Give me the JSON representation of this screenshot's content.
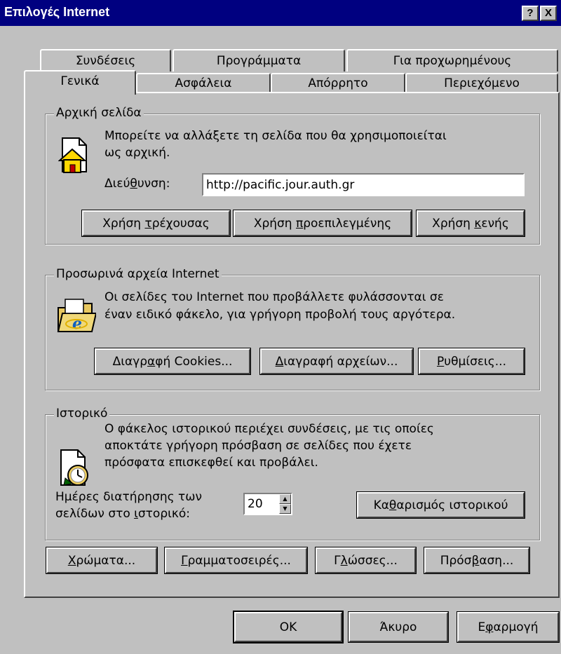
{
  "window": {
    "title": "Επιλογές Internet",
    "help_button": "?",
    "close_button": "X"
  },
  "tabs": {
    "row_back": [
      "Συνδέσεις",
      "Προγράμματα",
      "Για προχωρημένους"
    ],
    "row_front": [
      "Γενικά",
      "Ασφάλεια",
      "Απόρρητο",
      "Περιεχόμενο"
    ],
    "selected": "Γενικά"
  },
  "home_page": {
    "legend": "Αρχική σελίδα",
    "description_line1": "Μπορείτε να αλλάξετε τη σελίδα που θα χρησιμοποιείται",
    "description_line2": "ως αρχική.",
    "address_label_pre": "Διεύ",
    "address_label_ul": "θ",
    "address_label_post": "υνση:",
    "address_value": "http://pacific.jour.auth.gr",
    "btn_current_pre": "Χρήση ",
    "btn_current_ul": "τ",
    "btn_current_post": "ρέχουσας",
    "btn_default_pre": "Χρήση ",
    "btn_default_ul": "π",
    "btn_default_post": "ροεπιλεγμένης",
    "btn_blank_pre": "Χρήση ",
    "btn_blank_ul": "κ",
    "btn_blank_post": "ενής",
    "icon": "home-page-icon"
  },
  "temp_files": {
    "legend": "Προσωρινά αρχεία Internet",
    "description_line1": "Οι σελίδες του Internet που προβάλλετε φυλάσσονται σε",
    "description_line2": "έναν ειδικό φάκελο, για γρήγορη προβολή τους αργότερα.",
    "btn_cookies_pre": "Διαγρ",
    "btn_cookies_ul": "α",
    "btn_cookies_post": "φή Cookies...",
    "btn_files_pre": "",
    "btn_files_ul": "Δ",
    "btn_files_post": "ιαγραφή αρχείων...",
    "btn_settings_pre": "",
    "btn_settings_ul": "Ρ",
    "btn_settings_post": "υθμίσεις...",
    "icon": "ie-folder-icon"
  },
  "history": {
    "legend": "Ιστορικό",
    "description_line1": "Ο φάκελος ιστορικού περιέχει συνδέσεις, με τις οποίες",
    "description_line2": "αποκτάτε γρήγορη πρόσβαση σε σελίδες που έχετε",
    "description_line3": "πρόσφατα επισκεφθεί και προβάλει.",
    "days_label_line1": "Ημέρες διατήρησης των",
    "days_label_line2_pre": "σελίδων στο ",
    "days_label_line2_ul": "ι",
    "days_label_line2_post": "στορικό:",
    "days_value": "20",
    "btn_clear_pre": "Κα",
    "btn_clear_ul": "θ",
    "btn_clear_post": "αρισμός ιστορικού",
    "icon": "history-icon"
  },
  "bottom_buttons": {
    "colors_ul": "Χ",
    "colors_post": "ρώματα...",
    "fonts_ul": "Γ",
    "fonts_post": "ραμματοσειρές...",
    "languages_pre": "Γ",
    "languages_ul": "λ",
    "languages_post": "ώσσες...",
    "access_pre": "Πρόσ",
    "access_ul": "β",
    "access_post": "αση..."
  },
  "dialog_buttons": {
    "ok": "OK",
    "cancel": "Άκυρο",
    "apply_pre": "Ε",
    "apply_ul": "φ",
    "apply_post": "αρμογή"
  },
  "colors": {
    "titlebar": "#000080",
    "face": "#c0c0c0",
    "highlight": "#ffffff",
    "shadow": "#808080"
  }
}
